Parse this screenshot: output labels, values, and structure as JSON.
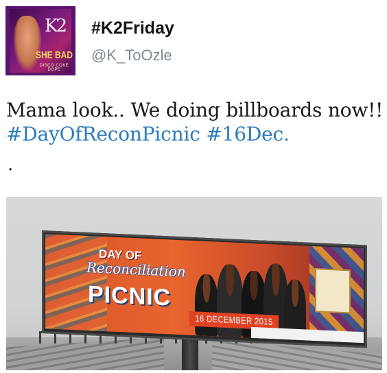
{
  "header": {
    "display_name": "#K2Friday",
    "handle": "@K_ToOzle"
  },
  "avatar": {
    "logo": "K2",
    "title": "SHE BAD",
    "subtitle": "DISCO COKE DOPE"
  },
  "tweet": {
    "text_plain": "Mama look.. We doing billboards now!!",
    "hashtags": [
      "#DayOfReconPicnic",
      "#16Dec."
    ],
    "trailing": "."
  },
  "photo": {
    "billboard": {
      "line1": "DAY OF",
      "line2": "Reconciliation",
      "line3": "PICNIC",
      "date": "16 DECEMBER 2015"
    }
  },
  "colors": {
    "hashtag": "#2b7bb9",
    "handle": "#7e8a93",
    "text": "#1a1a1a"
  }
}
